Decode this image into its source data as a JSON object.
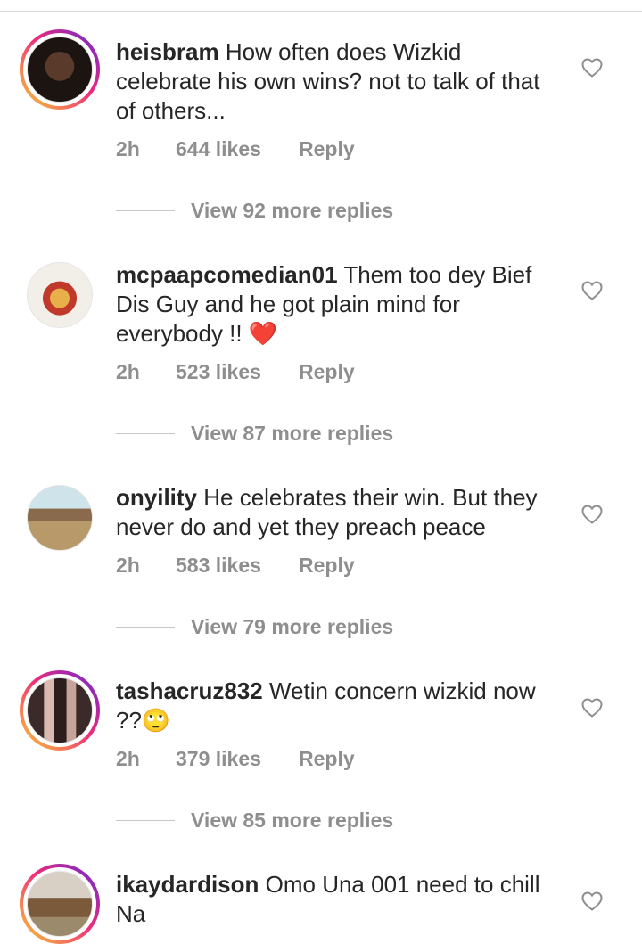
{
  "comments": [
    {
      "username": "heisbram",
      "text": " How often does Wizkid celebrate his own wins? not to talk of that of others...",
      "time": "2h",
      "likes": "644 likes",
      "reply": "Reply",
      "view_replies": "View 92 more replies",
      "story_ring": true
    },
    {
      "username": "mcpaapcomedian01",
      "text": " Them too dey Bief Dis Guy and he got plain mind for everybody !! ",
      "emoji": "❤️",
      "time": "2h",
      "likes": "523 likes",
      "reply": "Reply",
      "view_replies": "View 87 more replies",
      "story_ring": false
    },
    {
      "username": "onyility",
      "text": " He celebrates their win. But they never do and yet they preach peace",
      "time": "2h",
      "likes": "583 likes",
      "reply": "Reply",
      "view_replies": "View 79 more replies",
      "story_ring": false
    },
    {
      "username": "tashacruz832",
      "text": " Wetin concern wizkid now ??🙄",
      "time": "2h",
      "likes": "379 likes",
      "reply": "Reply",
      "view_replies": "View 85 more replies",
      "story_ring": true
    },
    {
      "username": "ikaydardison",
      "text": " Omo Una 001 need to chill Na",
      "story_ring": true
    }
  ],
  "icons": {
    "like": "heart-outline-icon"
  },
  "colors": {
    "text": "#262626",
    "muted": "#8e8e8e",
    "emoji_heart": "#ed1c24"
  }
}
